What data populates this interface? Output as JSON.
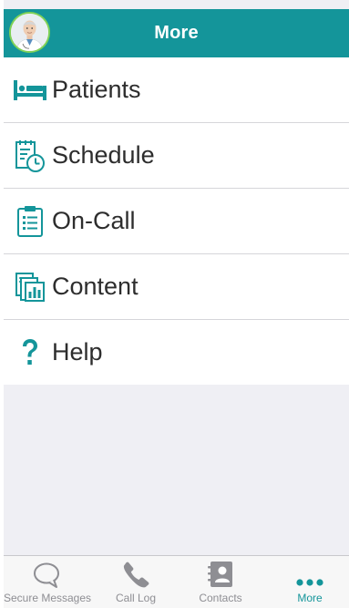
{
  "header": {
    "title": "More"
  },
  "menu": {
    "items": [
      {
        "label": "Patients",
        "icon": "hospital-bed-icon"
      },
      {
        "label": "Schedule",
        "icon": "calendar-clock-icon"
      },
      {
        "label": "On-Call",
        "icon": "clipboard-list-icon"
      },
      {
        "label": "Content",
        "icon": "documents-chart-icon"
      },
      {
        "label": "Help",
        "icon": "question-mark-icon"
      }
    ]
  },
  "tabbar": {
    "tabs": [
      {
        "label": "Secure Messages",
        "icon": "chat-bubble-icon",
        "active": false
      },
      {
        "label": "Call Log",
        "icon": "phone-icon",
        "active": false
      },
      {
        "label": "Contacts",
        "icon": "contact-book-icon",
        "active": false
      },
      {
        "label": "More",
        "icon": "more-dots-icon",
        "active": true
      }
    ]
  },
  "colors": {
    "brand": "#14959a",
    "avatar_ring": "#7fd157",
    "inactive_tab": "#8e8e93",
    "background": "#efeff4"
  }
}
